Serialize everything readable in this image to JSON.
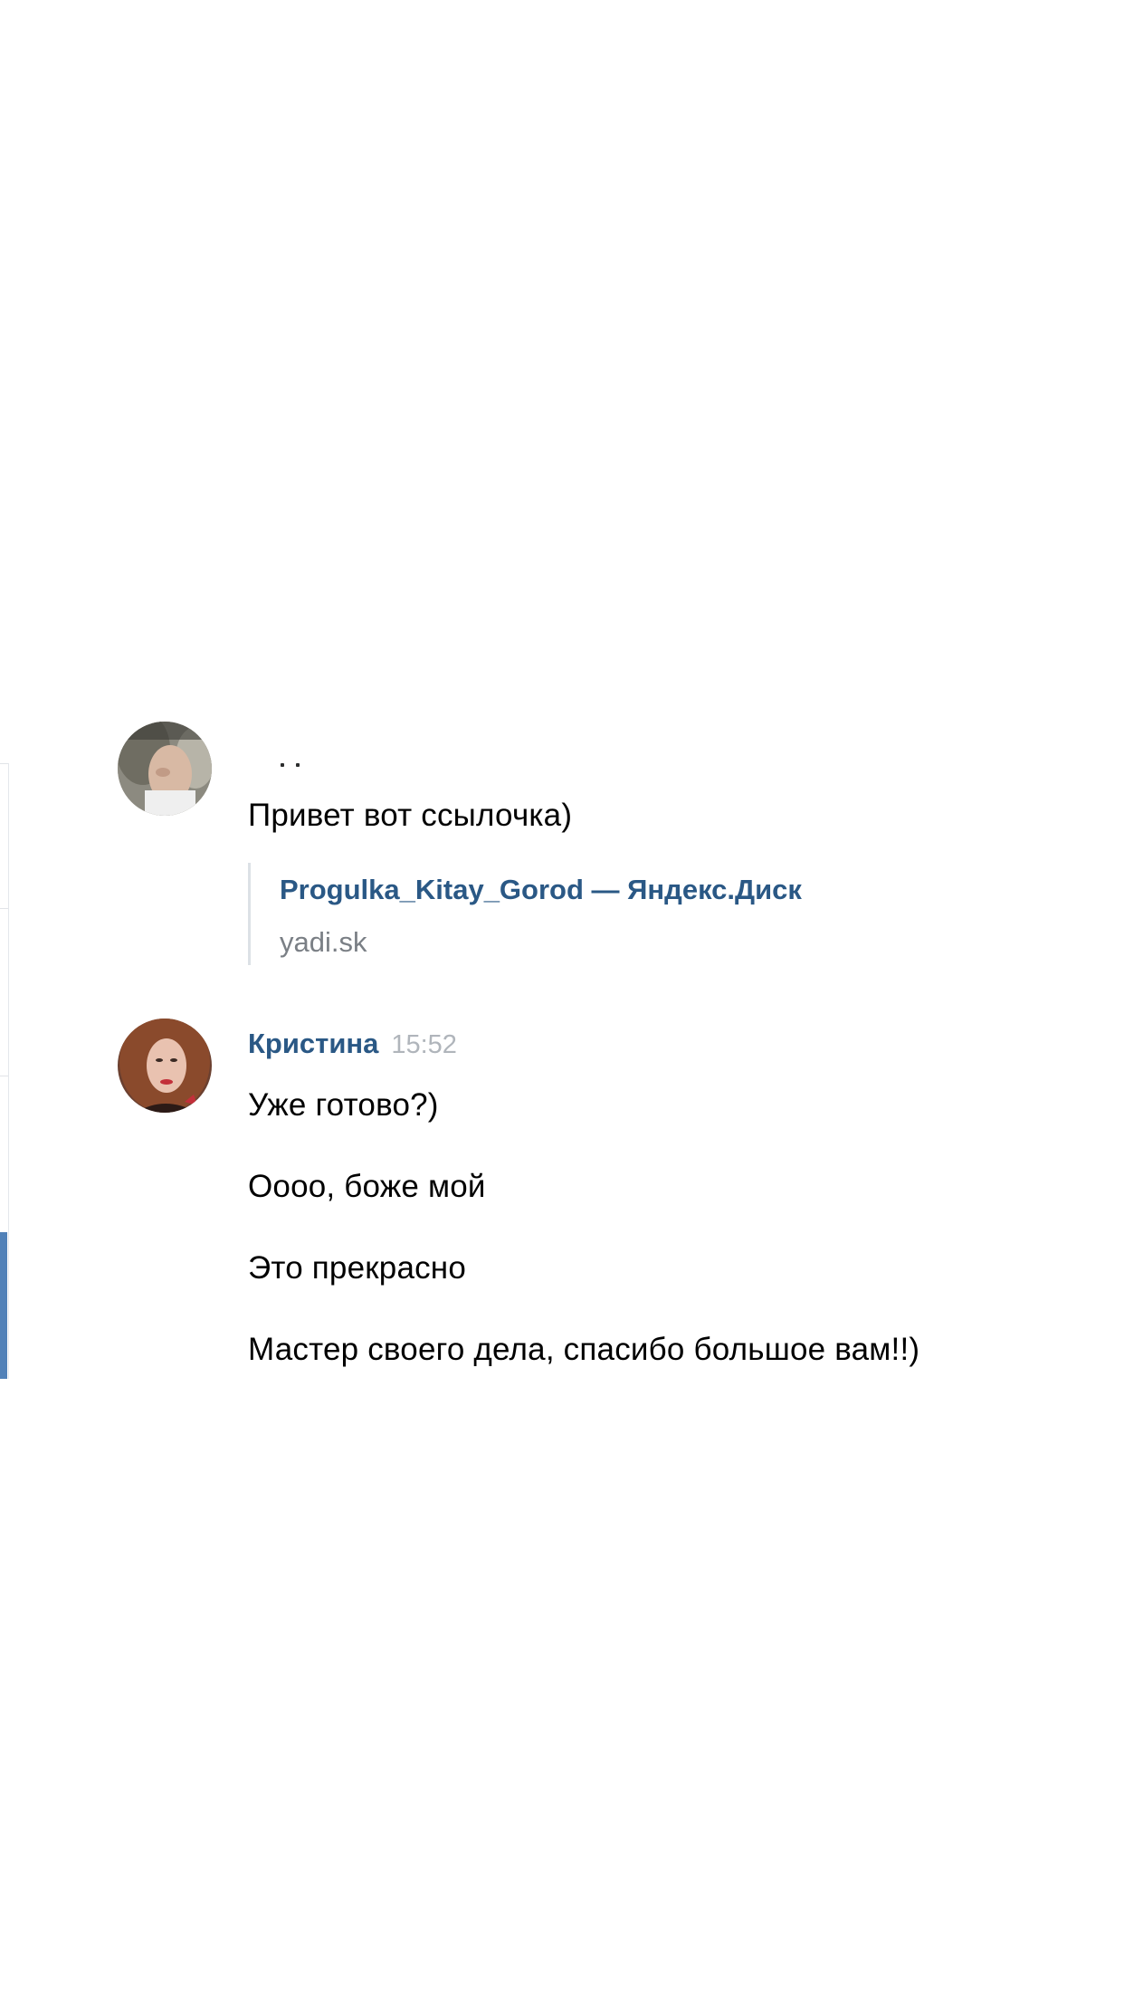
{
  "conversation": {
    "messages": [
      {
        "author": "",
        "texts": [
          "Привет вот ссылочка)"
        ],
        "link": {
          "title": "Progulka_Kitay_Gorod — Яндекс.Диск",
          "host": "yadi.sk"
        }
      },
      {
        "author": "Кристина",
        "time": "15:52",
        "texts": [
          "Уже готово?)",
          "Оооо, боже мой",
          "Это прекрасно",
          "Мастер своего дела, спасибо большое вам!!)"
        ]
      }
    ]
  },
  "colors": {
    "accent": "#5181b8",
    "link": "#2a5885",
    "secondary_text": "#7a7f85",
    "time": "#b0b5bb"
  }
}
